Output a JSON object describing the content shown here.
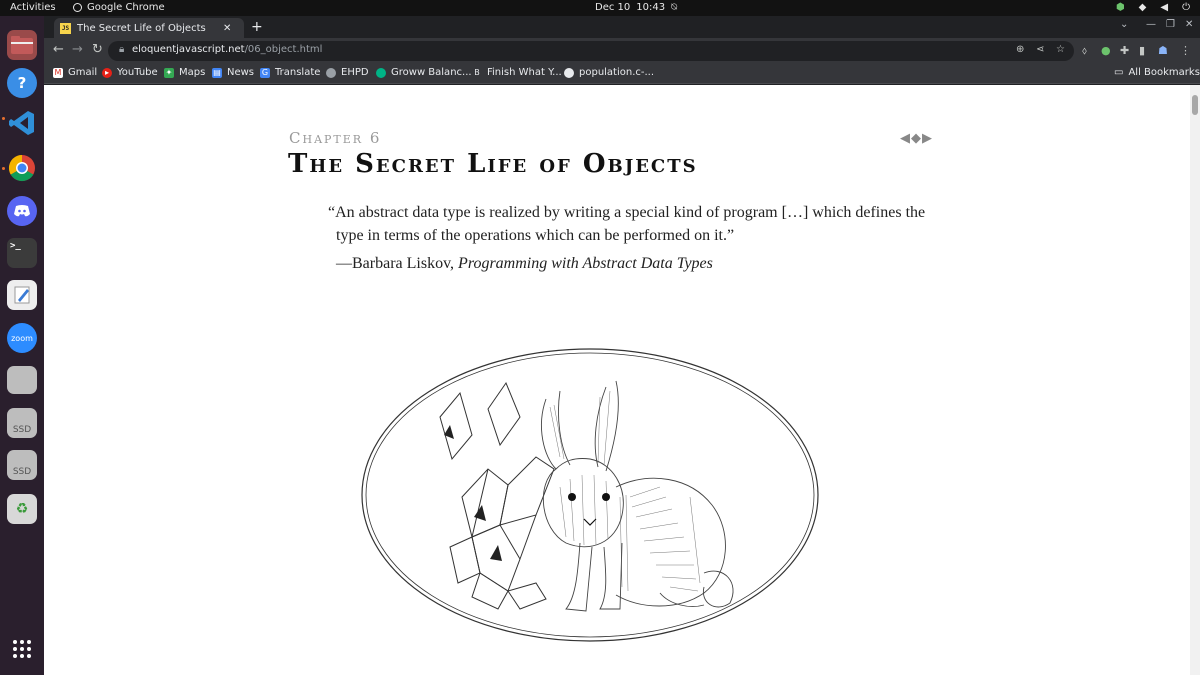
{
  "topbar": {
    "activities": "Activities",
    "app_name": "Google Chrome",
    "date": "Dec 10",
    "time": "10:43"
  },
  "dock": {
    "items": [
      "files-icon",
      "help-icon",
      "vscode-icon",
      "chrome-icon",
      "discord-icon",
      "terminal-icon",
      "text-editor-icon",
      "zoom-icon",
      "storage-icon",
      "ssd-icon",
      "ssd-icon",
      "trash-icon",
      "app-grid-icon"
    ],
    "zoom_label": "zoom",
    "ssd_label": "SSD"
  },
  "browser": {
    "tab_title": "The Secret Life of Objects",
    "tab_favicon": "JS",
    "url_host": "eloquentjavascript.net",
    "url_path": "/06_object.html",
    "bookmarks": [
      "Gmail",
      "YouTube",
      "Maps",
      "News",
      "Translate",
      "EHPD",
      "Groww Balanc...",
      "Finish What Y...",
      "population.c-..."
    ],
    "all_bookmarks": "All Bookmarks"
  },
  "page": {
    "chapter_label": "Chapter 6",
    "title": "The Secret Life of Objects",
    "quote": "“An abstract data type is realized by writing a special kind of program […] which defines the type in terms of the operations which can be performed on it.”",
    "attribution_author": "—Barbara Liskov, ",
    "attribution_work": "Programming with Abstract Data Types",
    "pager": "◀◆▶"
  },
  "colors": {
    "chrome_dark": "#202124",
    "chrome_toolbar": "#35363a",
    "dock_bg": "#2a1f2d",
    "topbar_bg": "#121212"
  }
}
